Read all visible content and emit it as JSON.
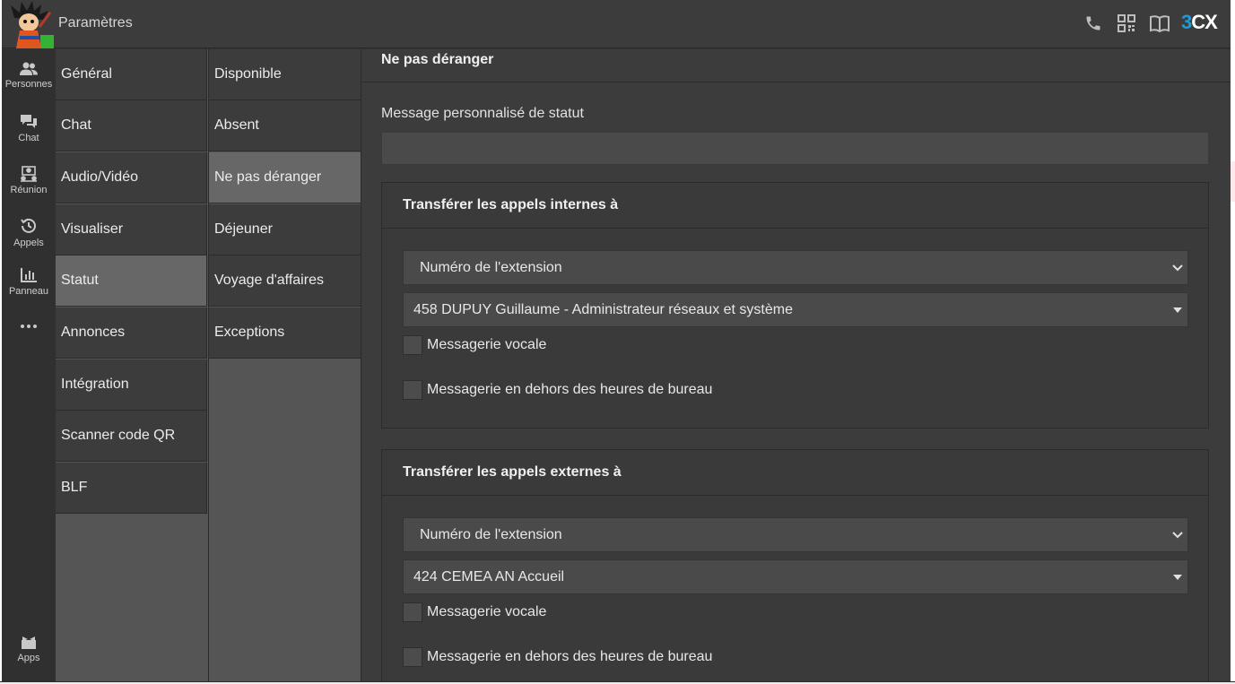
{
  "header": {
    "title": "Paramètres",
    "icons": [
      "phone-icon",
      "qr-code-icon",
      "book-icon"
    ],
    "brand": {
      "prefix": "3",
      "suffix": "CX"
    },
    "colors": {
      "status": "#34b233",
      "brand": "#1e9ad6"
    }
  },
  "rail": {
    "items": [
      {
        "label": "Personnes",
        "icon": "people-icon"
      },
      {
        "label": "Chat",
        "icon": "chat-icon"
      },
      {
        "label": "Réunion",
        "icon": "meeting-icon"
      },
      {
        "label": "Appels",
        "icon": "history-icon"
      },
      {
        "label": "Panneau",
        "icon": "chart-icon"
      },
      {
        "label": "",
        "icon": "more-icon"
      },
      {
        "label": "Apps",
        "icon": "apps-icon"
      }
    ]
  },
  "settings_menu": {
    "items": [
      "Général",
      "Chat",
      "Audio/Vidéo",
      "Visualiser",
      "Statut",
      "Annonces",
      "Intégration",
      "Scanner code QR",
      "BLF"
    ],
    "active": "Statut"
  },
  "status_menu": {
    "items": [
      "Disponible",
      "Absent",
      "Ne pas déranger",
      "Déjeuner",
      "Voyage d'affaires",
      "Exceptions"
    ],
    "active": "Ne pas déranger"
  },
  "content": {
    "title": "Ne pas déranger",
    "status_message_label": "Message personnalisé de statut",
    "status_message_value": "",
    "internal": {
      "title": "Transférer les appels internes à",
      "forward_type": "Numéro de l'extension",
      "extension": "458 DUPUY Guillaume - Administrateur réseaux et système",
      "voicemail_label": "Messagerie vocale",
      "voicemail_checked": false,
      "after_hours_label": "Messagerie en dehors des heures de bureau",
      "after_hours_checked": false
    },
    "external": {
      "title": "Transférer les appels externes à",
      "forward_type": "Numéro de l'extension",
      "extension": "424 CEMEA AN Accueil",
      "voicemail_label": "Messagerie vocale",
      "voicemail_checked": false,
      "after_hours_label": "Messagerie en dehors des heures de bureau",
      "after_hours_checked": false
    }
  }
}
